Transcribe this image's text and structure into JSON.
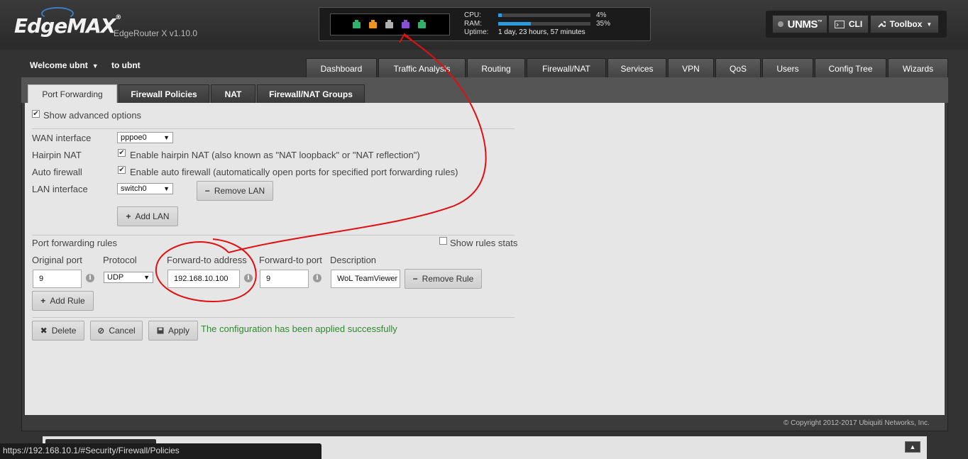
{
  "header": {
    "logo": "EdgeMAX",
    "logo_mark": "®",
    "model": "EdgeRouter X v1.10.0",
    "ports": [
      {
        "color": "#2fb36a"
      },
      {
        "color": "#f0931e"
      },
      {
        "color": "#b0b0b0"
      },
      {
        "color": "#8a4fd6"
      },
      {
        "color": "#2fb36a"
      }
    ],
    "cpu_label": "CPU:",
    "cpu_value": "4%",
    "cpu_fraction": 0.04,
    "ram_label": "RAM:",
    "ram_value": "35%",
    "ram_fraction": 0.35,
    "uptime_label": "Uptime:",
    "uptime_value": "1 day, 23 hours, 57 minutes",
    "unms_label": "UNMS",
    "unms_mark": "™",
    "cli_label": "CLI",
    "toolbox_label": "Toolbox"
  },
  "user": {
    "welcome": "Welcome ubnt",
    "to": "to ubnt"
  },
  "nav": {
    "tabs": [
      "Dashboard",
      "Traffic Analysis",
      "Routing",
      "Firewall/NAT",
      "Services",
      "VPN",
      "QoS",
      "Users",
      "Config Tree",
      "Wizards"
    ],
    "active": "Firewall/NAT"
  },
  "subnav": {
    "tabs": [
      "Port Forwarding",
      "Firewall Policies",
      "NAT",
      "Firewall/NAT Groups"
    ],
    "active": "Port Forwarding"
  },
  "form": {
    "show_advanced": "Show advanced options",
    "wan_label": "WAN interface",
    "wan_value": "pppoe0",
    "hairpin_label": "Hairpin NAT",
    "hairpin_text": "Enable hairpin NAT (also known as \"NAT loopback\" or \"NAT reflection\")",
    "autofw_label": "Auto firewall",
    "autofw_text": "Enable auto firewall (automatically open ports for specified port forwarding rules)",
    "lan_label": "LAN interface",
    "lan_value": "switch0",
    "remove_lan": "Remove LAN",
    "add_lan": "Add LAN",
    "rules_title": "Port forwarding rules",
    "show_stats": "Show rules stats",
    "col_orig_port": "Original port",
    "col_protocol": "Protocol",
    "col_fwd_addr": "Forward-to address",
    "col_fwd_port": "Forward-to port",
    "col_desc": "Description",
    "rule": {
      "orig_port": "9",
      "protocol": "UDP",
      "fwd_addr": "192.168.10.100",
      "fwd_port": "9",
      "desc": "WoL TeamViewer"
    },
    "remove_rule": "Remove Rule",
    "add_rule": "Add Rule",
    "delete": "Delete",
    "cancel": "Cancel",
    "apply": "Apply",
    "success": "The configuration has been applied successfully"
  },
  "footer": {
    "copyright": "© Copyright 2012-2017 Ubiquiti Networks, Inc.",
    "status_url": "https://192.168.10.1/#Security/Firewall/Policies"
  },
  "annotation_color": "#e01010"
}
